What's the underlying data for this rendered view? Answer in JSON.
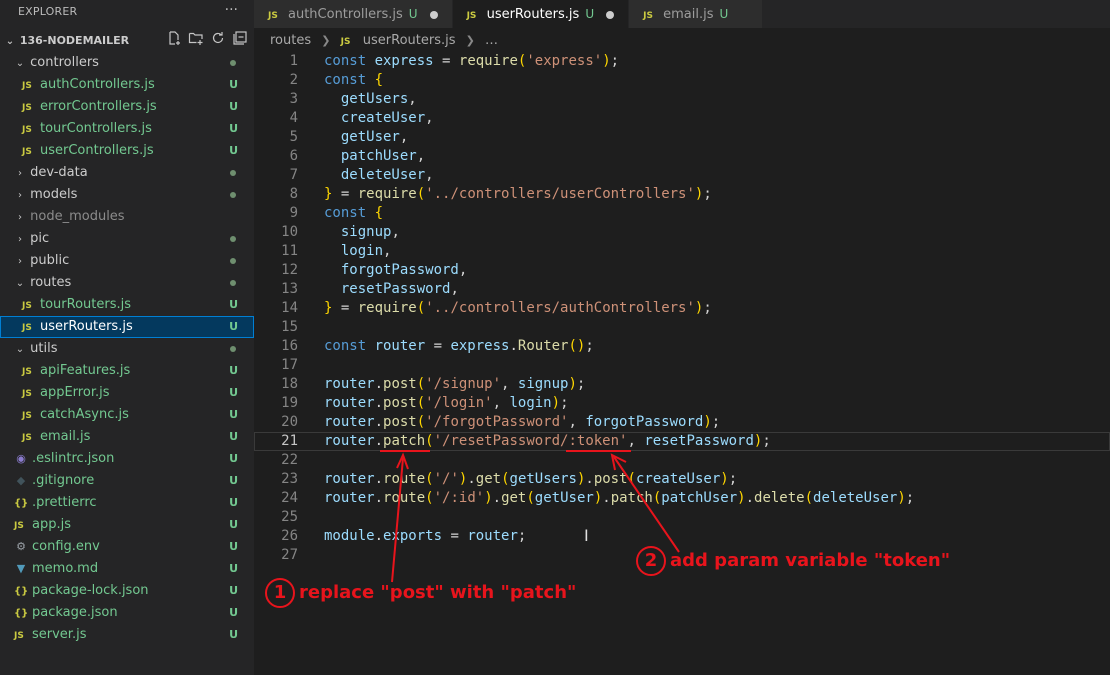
{
  "sidebar": {
    "title": "EXPLORER",
    "more": "···",
    "project": "136-NODEMAILER",
    "items": [
      {
        "label": "controllers",
        "type": "folder",
        "open": true,
        "indent": 0,
        "status": "dot"
      },
      {
        "label": "authControllers.js",
        "type": "js",
        "indent": 1,
        "status": "U"
      },
      {
        "label": "errorControllers.js",
        "type": "js",
        "indent": 1,
        "status": "U"
      },
      {
        "label": "tourControllers.js",
        "type": "js",
        "indent": 1,
        "status": "U"
      },
      {
        "label": "userControllers.js",
        "type": "js",
        "indent": 1,
        "status": "U"
      },
      {
        "label": "dev-data",
        "type": "folder",
        "open": false,
        "indent": 0,
        "status": "dot"
      },
      {
        "label": "models",
        "type": "folder",
        "open": false,
        "indent": 0,
        "status": "dot"
      },
      {
        "label": "node_modules",
        "type": "folder",
        "open": false,
        "indent": 0,
        "status": "",
        "dim": true
      },
      {
        "label": "pic",
        "type": "folder",
        "open": false,
        "indent": 0,
        "status": "dot"
      },
      {
        "label": "public",
        "type": "folder",
        "open": false,
        "indent": 0,
        "status": "dot"
      },
      {
        "label": "routes",
        "type": "folder",
        "open": true,
        "indent": 0,
        "status": "dot"
      },
      {
        "label": "tourRouters.js",
        "type": "js",
        "indent": 1,
        "status": "U"
      },
      {
        "label": "userRouters.js",
        "type": "js",
        "indent": 1,
        "status": "U",
        "selected": true
      },
      {
        "label": "utils",
        "type": "folder",
        "open": true,
        "indent": 0,
        "status": "dot"
      },
      {
        "label": "apiFeatures.js",
        "type": "js",
        "indent": 1,
        "status": "U"
      },
      {
        "label": "appError.js",
        "type": "js",
        "indent": 1,
        "status": "U"
      },
      {
        "label": "catchAsync.js",
        "type": "js",
        "indent": 1,
        "status": "U"
      },
      {
        "label": "email.js",
        "type": "js",
        "indent": 1,
        "status": "U"
      },
      {
        "label": ".eslintrc.json",
        "type": "eslint",
        "indent": 0,
        "status": "U"
      },
      {
        "label": ".gitignore",
        "type": "git",
        "indent": 0,
        "status": "U"
      },
      {
        "label": ".prettierrc",
        "type": "json",
        "indent": 0,
        "status": "U"
      },
      {
        "label": "app.js",
        "type": "js",
        "indent": 0,
        "status": "U"
      },
      {
        "label": "config.env",
        "type": "gear",
        "indent": 0,
        "status": "U"
      },
      {
        "label": "memo.md",
        "type": "md",
        "indent": 0,
        "status": "U"
      },
      {
        "label": "package-lock.json",
        "type": "json",
        "indent": 0,
        "status": "U"
      },
      {
        "label": "package.json",
        "type": "json",
        "indent": 0,
        "status": "U"
      },
      {
        "label": "server.js",
        "type": "js",
        "indent": 0,
        "status": "U"
      }
    ]
  },
  "tabs": [
    {
      "icon": "JS",
      "label": "authControllers.js",
      "status": "U",
      "dirty": true,
      "active": false
    },
    {
      "icon": "JS",
      "label": "userRouters.js",
      "status": "U",
      "dirty": true,
      "active": true
    },
    {
      "icon": "JS",
      "label": "email.js",
      "status": "U",
      "dirty": false,
      "active": false
    }
  ],
  "breadcrumb": {
    "folder": "routes",
    "icon": "JS",
    "file": "userRouters.js",
    "more": "…"
  },
  "code": [
    [
      [
        "kw",
        "const "
      ],
      [
        "var",
        "express"
      ],
      [
        "pun",
        " = "
      ],
      [
        "fn",
        "require"
      ],
      [
        "br",
        "("
      ],
      [
        "str",
        "'express'"
      ],
      [
        "br",
        ")"
      ],
      [
        "pun",
        ";"
      ]
    ],
    [
      [
        "kw",
        "const "
      ],
      [
        "br",
        "{"
      ]
    ],
    [
      [
        "pun",
        "  "
      ],
      [
        "var",
        "getUsers"
      ],
      [
        "pun",
        ","
      ]
    ],
    [
      [
        "pun",
        "  "
      ],
      [
        "var",
        "createUser"
      ],
      [
        "pun",
        ","
      ]
    ],
    [
      [
        "pun",
        "  "
      ],
      [
        "var",
        "getUser"
      ],
      [
        "pun",
        ","
      ]
    ],
    [
      [
        "pun",
        "  "
      ],
      [
        "var",
        "patchUser"
      ],
      [
        "pun",
        ","
      ]
    ],
    [
      [
        "pun",
        "  "
      ],
      [
        "var",
        "deleteUser"
      ],
      [
        "pun",
        ","
      ]
    ],
    [
      [
        "br",
        "}"
      ],
      [
        "pun",
        " = "
      ],
      [
        "fn",
        "require"
      ],
      [
        "br",
        "("
      ],
      [
        "str",
        "'../controllers/userControllers'"
      ],
      [
        "br",
        ")"
      ],
      [
        "pun",
        ";"
      ]
    ],
    [
      [
        "kw",
        "const "
      ],
      [
        "br",
        "{"
      ]
    ],
    [
      [
        "pun",
        "  "
      ],
      [
        "var",
        "signup"
      ],
      [
        "pun",
        ","
      ]
    ],
    [
      [
        "pun",
        "  "
      ],
      [
        "var",
        "login"
      ],
      [
        "pun",
        ","
      ]
    ],
    [
      [
        "pun",
        "  "
      ],
      [
        "var",
        "forgotPassword"
      ],
      [
        "pun",
        ","
      ]
    ],
    [
      [
        "pun",
        "  "
      ],
      [
        "var",
        "resetPassword"
      ],
      [
        "pun",
        ","
      ]
    ],
    [
      [
        "br",
        "}"
      ],
      [
        "pun",
        " = "
      ],
      [
        "fn",
        "require"
      ],
      [
        "br",
        "("
      ],
      [
        "str",
        "'../controllers/authControllers'"
      ],
      [
        "br",
        ")"
      ],
      [
        "pun",
        ";"
      ]
    ],
    [],
    [
      [
        "kw",
        "const "
      ],
      [
        "var",
        "router"
      ],
      [
        "pun",
        " = "
      ],
      [
        "var",
        "express"
      ],
      [
        "pun",
        "."
      ],
      [
        "fn",
        "Router"
      ],
      [
        "br",
        "()"
      ],
      [
        "pun",
        ";"
      ]
    ],
    [],
    [
      [
        "var",
        "router"
      ],
      [
        "pun",
        "."
      ],
      [
        "fn",
        "post"
      ],
      [
        "br",
        "("
      ],
      [
        "str",
        "'/signup'"
      ],
      [
        "pun",
        ", "
      ],
      [
        "var",
        "signup"
      ],
      [
        "br",
        ")"
      ],
      [
        "pun",
        ";"
      ]
    ],
    [
      [
        "var",
        "router"
      ],
      [
        "pun",
        "."
      ],
      [
        "fn",
        "post"
      ],
      [
        "br",
        "("
      ],
      [
        "str",
        "'/login'"
      ],
      [
        "pun",
        ", "
      ],
      [
        "var",
        "login"
      ],
      [
        "br",
        ")"
      ],
      [
        "pun",
        ";"
      ]
    ],
    [
      [
        "var",
        "router"
      ],
      [
        "pun",
        "."
      ],
      [
        "fn",
        "post"
      ],
      [
        "br",
        "("
      ],
      [
        "str",
        "'/forgotPassword'"
      ],
      [
        "pun",
        ", "
      ],
      [
        "var",
        "forgotPassword"
      ],
      [
        "br",
        ")"
      ],
      [
        "pun",
        ";"
      ]
    ],
    [
      [
        "var",
        "router"
      ],
      [
        "pun",
        "."
      ],
      [
        "fn",
        "patch"
      ],
      [
        "br",
        "("
      ],
      [
        "str",
        "'/resetPassword/:token'"
      ],
      [
        "pun",
        ", "
      ],
      [
        "var",
        "resetPassword"
      ],
      [
        "br",
        ")"
      ],
      [
        "pun",
        ";"
      ]
    ],
    [],
    [
      [
        "var",
        "router"
      ],
      [
        "pun",
        "."
      ],
      [
        "fn",
        "route"
      ],
      [
        "br",
        "("
      ],
      [
        "str",
        "'/'"
      ],
      [
        "br",
        ")"
      ],
      [
        "pun",
        "."
      ],
      [
        "fn",
        "get"
      ],
      [
        "br",
        "("
      ],
      [
        "var",
        "getUsers"
      ],
      [
        "br",
        ")"
      ],
      [
        "pun",
        "."
      ],
      [
        "fn",
        "post"
      ],
      [
        "br",
        "("
      ],
      [
        "var",
        "createUser"
      ],
      [
        "br",
        ")"
      ],
      [
        "pun",
        ";"
      ]
    ],
    [
      [
        "var",
        "router"
      ],
      [
        "pun",
        "."
      ],
      [
        "fn",
        "route"
      ],
      [
        "br",
        "("
      ],
      [
        "str",
        "'/:id'"
      ],
      [
        "br",
        ")"
      ],
      [
        "pun",
        "."
      ],
      [
        "fn",
        "get"
      ],
      [
        "br",
        "("
      ],
      [
        "var",
        "getUser"
      ],
      [
        "br",
        ")"
      ],
      [
        "pun",
        "."
      ],
      [
        "fn",
        "patch"
      ],
      [
        "br",
        "("
      ],
      [
        "var",
        "patchUser"
      ],
      [
        "br",
        ")"
      ],
      [
        "pun",
        "."
      ],
      [
        "fn",
        "delete"
      ],
      [
        "br",
        "("
      ],
      [
        "var",
        "deleteUser"
      ],
      [
        "br",
        ")"
      ],
      [
        "pun",
        ";"
      ]
    ],
    [],
    [
      [
        "var",
        "module"
      ],
      [
        "pun",
        "."
      ],
      [
        "var",
        "exports"
      ],
      [
        "pun",
        " = "
      ],
      [
        "var",
        "router"
      ],
      [
        "pun",
        ";"
      ]
    ],
    []
  ],
  "current_line": 21,
  "annotations": {
    "a1": {
      "num": "1",
      "text": "replace \"post\" with \"patch\""
    },
    "a2": {
      "num": "2",
      "text": "add param variable \"token\""
    }
  },
  "colors": {
    "accent": "#007fd4",
    "annotation": "#e8141c",
    "untracked": "#73c991"
  }
}
